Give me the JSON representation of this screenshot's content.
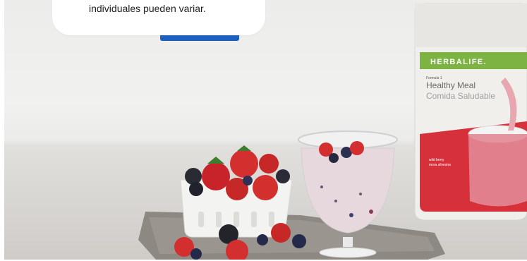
{
  "hero": {
    "caption": "individuales pueden variar.",
    "product": {
      "brand": "HERBALIFE.",
      "line": "Formula 1",
      "name_en": "Healthy Meal",
      "name_es": "Comida Saludable",
      "flavor_en": "wild berry",
      "flavor_es": "mora silvestre"
    }
  },
  "colors": {
    "brand_green": "#7cb342",
    "cta_blue": "#1f5fc2",
    "label_red": "#d6313a"
  }
}
